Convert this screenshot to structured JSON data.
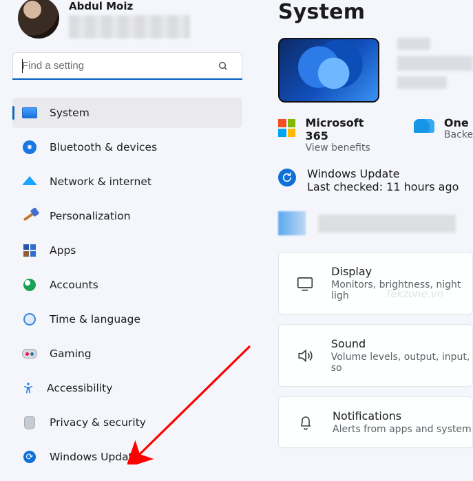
{
  "user": {
    "name": "Abdul Moiz"
  },
  "search": {
    "placeholder": "Find a setting"
  },
  "nav": {
    "items": [
      {
        "label": "System"
      },
      {
        "label": "Bluetooth & devices"
      },
      {
        "label": "Network & internet"
      },
      {
        "label": "Personalization"
      },
      {
        "label": "Apps"
      },
      {
        "label": "Accounts"
      },
      {
        "label": "Time & language"
      },
      {
        "label": "Gaming"
      },
      {
        "label": "Accessibility"
      },
      {
        "label": "Privacy & security"
      },
      {
        "label": "Windows Update"
      }
    ]
  },
  "page": {
    "title": "System"
  },
  "services": {
    "ms365": {
      "title": "Microsoft 365",
      "sub": "View benefits"
    },
    "onedrive": {
      "title": "One",
      "sub": "Backe"
    },
    "wu": {
      "title": "Windows Update",
      "sub": "Last checked: 11 hours ago"
    }
  },
  "cards": [
    {
      "title": "Display",
      "sub": "Monitors, brightness, night ligh"
    },
    {
      "title": "Sound",
      "sub": "Volume levels, output, input, so"
    },
    {
      "title": "Notifications",
      "sub": "Alerts from apps and system"
    }
  ],
  "watermark": "Tekzone.vn"
}
